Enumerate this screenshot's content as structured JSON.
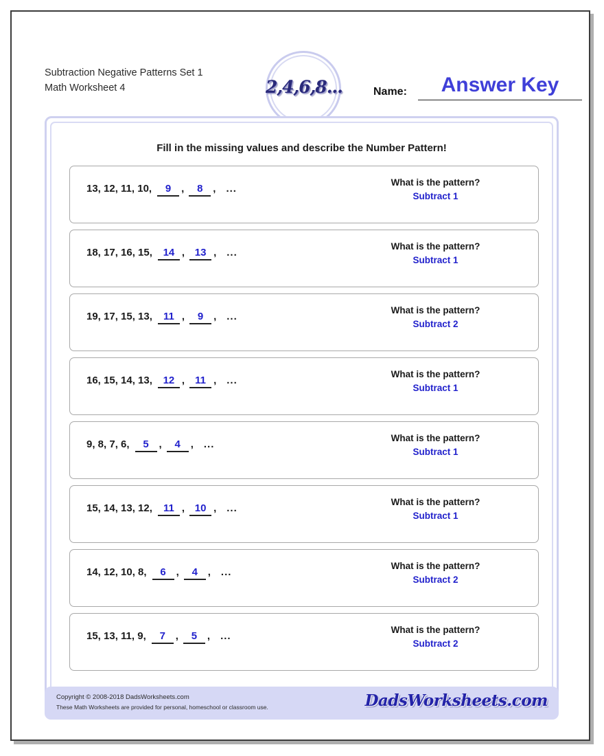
{
  "header": {
    "title": "Subtraction Negative Patterns Set 1",
    "subtitle": "Math Worksheet 4",
    "logo_text": "2,4,6,8...",
    "name_label": "Name:",
    "answer_key": "Answer Key"
  },
  "instructions": "Fill in the missing values and describe the Number Pattern!",
  "pattern_question": "What is the pattern?",
  "ellipsis": "...",
  "problems": [
    {
      "given": "13,  12,  11,  10,",
      "blank1": "9",
      "blank2": "8",
      "pattern_question": "What is the pattern?",
      "pattern_answer": "Subtract 1"
    },
    {
      "given": "18,  17,  16,  15,",
      "blank1": "14",
      "blank2": "13",
      "pattern_question": "What is the pattern?",
      "pattern_answer": "Subtract 1"
    },
    {
      "given": "19,  17,  15,  13,",
      "blank1": "11",
      "blank2": "9",
      "pattern_question": "What is the pattern?",
      "pattern_answer": "Subtract 2"
    },
    {
      "given": "16,  15,  14,  13,",
      "blank1": "12",
      "blank2": "11",
      "pattern_question": "What is the pattern?",
      "pattern_answer": "Subtract 1"
    },
    {
      "given": "9, 8, 7, 6,",
      "blank1": "5",
      "blank2": "4",
      "pattern_question": "What is the pattern?",
      "pattern_answer": "Subtract 1"
    },
    {
      "given": "15,  14,  13,  12,",
      "blank1": "11",
      "blank2": "10",
      "pattern_question": "What is the pattern?",
      "pattern_answer": "Subtract 1"
    },
    {
      "given": "14,  12,  10,  8,",
      "blank1": "6",
      "blank2": "4",
      "pattern_question": "What is the pattern?",
      "pattern_answer": "Subtract 2"
    },
    {
      "given": "15,  13,  11,  9,",
      "blank1": "7",
      "blank2": "5",
      "pattern_question": "What is the pattern?",
      "pattern_answer": "Subtract 2"
    }
  ],
  "footer": {
    "copyright": "Copyright © 2008-2018 DadsWorksheets.com",
    "usage": "These Math Worksheets are provided for personal, homeschool or classroom use.",
    "logo_text": "DadsWorksheets.com"
  },
  "colors": {
    "answer_blue": "#2222cc",
    "answer_key_blue": "#3f3fd8",
    "frame_lavender": "#cfd1f0",
    "footer_lavender": "#d6d8f5"
  }
}
